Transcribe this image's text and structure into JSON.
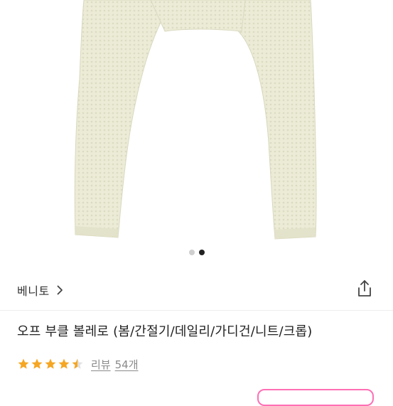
{
  "gallery": {
    "total": 2,
    "active_index": 1
  },
  "brand": {
    "name": "베니토"
  },
  "product": {
    "title": "오프 부클 볼레로 (봄/간절기/데일리/가디건/니트/크롭)"
  },
  "rating": {
    "value": 4.5,
    "max": 5,
    "review_label": "리뷰",
    "review_count": "54개"
  },
  "icons": {
    "chevron": "chevron-right-icon",
    "share": "share-icon",
    "star": "star-icon"
  },
  "colors": {
    "knit": "#ececd8",
    "star": "#f5a623",
    "accent_pink": "#ff6fb5"
  }
}
